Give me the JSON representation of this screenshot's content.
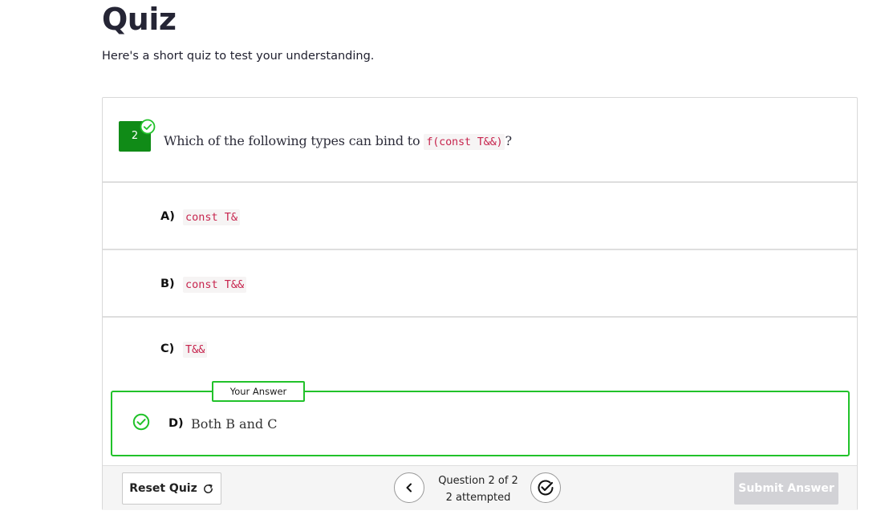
{
  "page": {
    "title": "Quiz",
    "subtitle": "Here's a short quiz to test your understanding."
  },
  "question": {
    "number": "2",
    "text_before": "Which of the following types can bind to ",
    "code": "f(const T&&)",
    "text_after": "?"
  },
  "options": [
    {
      "letter": "A)",
      "value": "const T&"
    },
    {
      "letter": "B)",
      "value": "const T&&"
    },
    {
      "letter": "C)",
      "value": "T&&"
    }
  ],
  "selected_answer": {
    "badge": "Your Answer",
    "letter": "D)",
    "text": "Both B and C"
  },
  "footer": {
    "reset_label": "Reset Quiz",
    "question_position": "Question 2 of 2",
    "attempted": "2 attempted",
    "submit_label": "Submit Answer"
  },
  "colors": {
    "correct_green": "#21c22a",
    "number_badge": "#108b17",
    "code_text": "#c7254e",
    "submit_disabled": "#d2d2d6"
  },
  "icons": {
    "question_status": "check-circle-icon",
    "answer_status": "check-circle-icon",
    "reset": "refresh-icon",
    "prev": "chevron-left-icon",
    "mark": "check-badge-icon"
  }
}
